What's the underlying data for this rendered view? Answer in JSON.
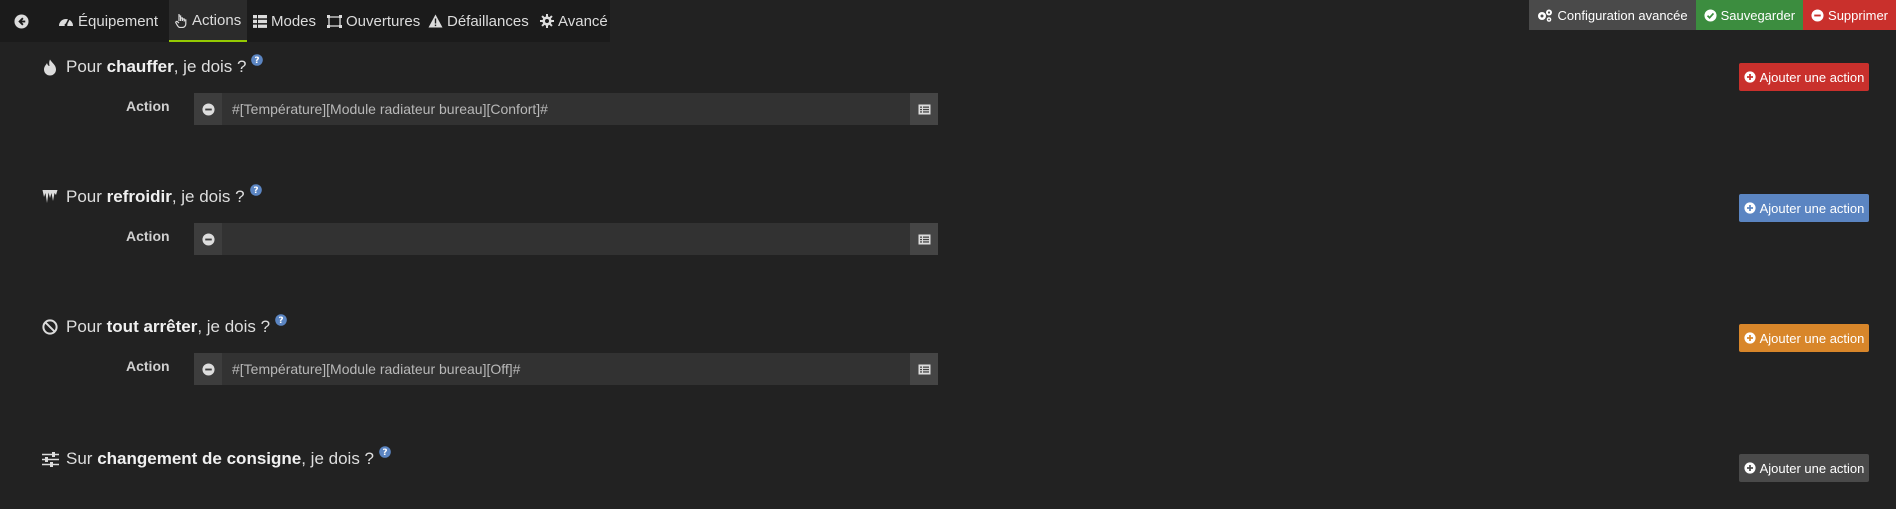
{
  "nav": {
    "back_icon": "arrow-left-circle-icon",
    "tabs": [
      {
        "label": "Équipement",
        "icon": "dashboard-icon"
      },
      {
        "label": "Actions",
        "icon": "hand-pointer-icon",
        "active": true
      },
      {
        "label": "Modes",
        "icon": "list-icon"
      },
      {
        "label": "Ouvertures",
        "icon": "window-icon"
      },
      {
        "label": "Défaillances",
        "icon": "warning-icon"
      },
      {
        "label": "Avancé",
        "icon": "cog-icon"
      }
    ],
    "active_color": "#94ca02"
  },
  "toolbar": {
    "config_label": "Configuration avancée",
    "save_label": "Sauvegarder",
    "delete_label": "Supprimer",
    "config_color": "#4a4a4a",
    "save_color": "#3c8d3f",
    "delete_color": "#c9302c"
  },
  "sections": [
    {
      "prefix": "Pour ",
      "bold": "chauffer",
      "suffix": ", je dois ?",
      "icon": "fire-icon",
      "action_label": "Action",
      "action_value": "#[Température][Module radiateur bureau][Confort]#",
      "add_label": "Ajouter une action",
      "add_color": "#c9302c"
    },
    {
      "prefix": "Pour ",
      "bold": "refroidir",
      "suffix": ", je dois ?",
      "icon": "icicles-icon",
      "action_label": "Action",
      "action_value": "",
      "add_label": "Ajouter une action",
      "add_color": "#5b85c2"
    },
    {
      "prefix": "Pour ",
      "bold": "tout arrêter",
      "suffix": ", je dois ?",
      "icon": "ban-icon",
      "action_label": "Action",
      "action_value": "#[Température][Module radiateur bureau][Off]#",
      "add_label": "Ajouter une action",
      "add_color": "#d8862a"
    },
    {
      "prefix": "Sur ",
      "bold": "changement de consigne",
      "suffix": ", je dois ?",
      "icon": "sliders-icon",
      "add_label": "Ajouter une action",
      "add_color": "#4a4a4a"
    }
  ]
}
